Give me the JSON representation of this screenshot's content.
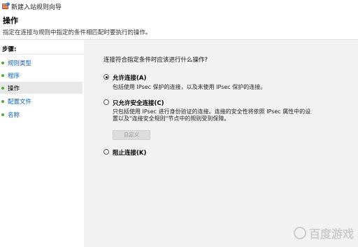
{
  "window": {
    "title": "新建入站规则向导"
  },
  "header": {
    "title": "操作",
    "description": "指定在连接与规则中指定的条件相匹配时要执行的操作。"
  },
  "steps": {
    "header": "步骤:",
    "items": [
      {
        "label": "规则类型",
        "current": false
      },
      {
        "label": "程序",
        "current": false
      },
      {
        "label": "操作",
        "current": true
      },
      {
        "label": "配置文件",
        "current": false
      },
      {
        "label": "名称",
        "current": false
      }
    ]
  },
  "main": {
    "question": "连接符合指定条件时应该进行什么操作?",
    "options": [
      {
        "label": "允许连接(A)",
        "selected": true,
        "description": [
          "包括使用 IPsec 保护的连接，以及未使用 IPsec 保护的连接。"
        ]
      },
      {
        "label": "只允许安全连接(C)",
        "selected": false,
        "description": [
          "只包括使用 IPsec 进行身份验证的连接。连接的安全性将依照 IPsec 属性中的设",
          "置以及\"连接安全规则\"节点中的规则受到保障。"
        ]
      },
      {
        "label": "阻止连接(K)",
        "selected": false,
        "description": []
      }
    ],
    "customize_button": "自定义"
  },
  "watermark": {
    "text": "百度游戏"
  },
  "colors": {
    "step_link": "#0b5fbf",
    "step_bullet": "#4caf2a",
    "content_bg": "#f2f2f2"
  }
}
